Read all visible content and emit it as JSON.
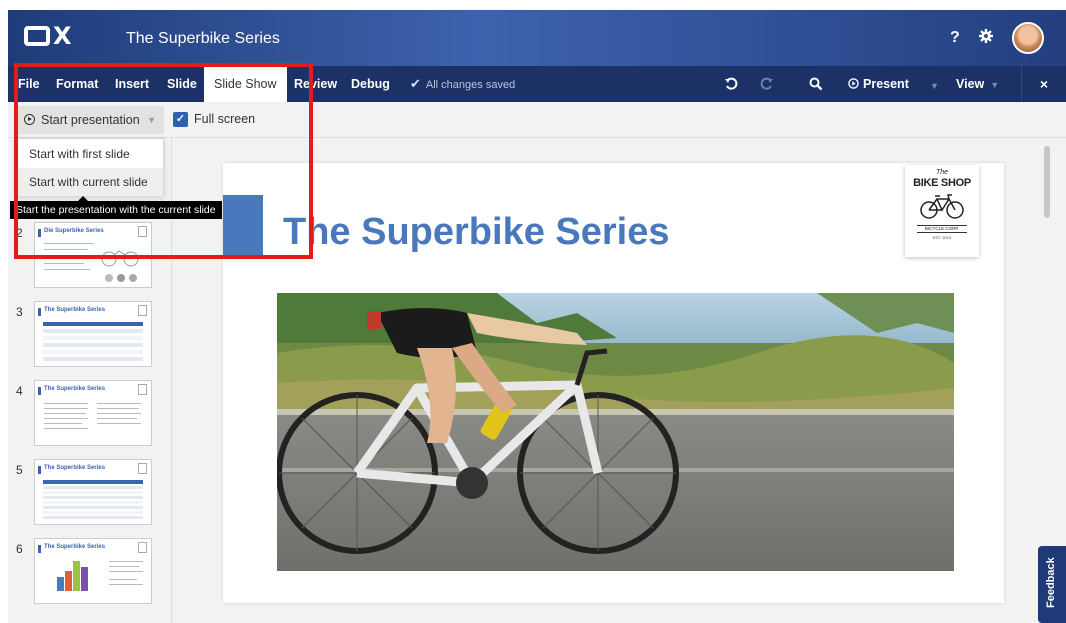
{
  "app": {
    "logo": "OX",
    "document_title": "The Superbike Series",
    "help_icon": "?",
    "settings_icon": "gear-icon",
    "avatar": "user-avatar"
  },
  "ribbon": {
    "tabs": [
      {
        "label": "File"
      },
      {
        "label": "Format"
      },
      {
        "label": "Insert"
      },
      {
        "label": "Slide"
      },
      {
        "label": "Slide Show",
        "active": true
      },
      {
        "label": "Review"
      },
      {
        "label": "Debug"
      }
    ],
    "status": "All changes saved",
    "present_label": "Present",
    "view_label": "View",
    "close_label": "×"
  },
  "toolbar": {
    "start_presentation_label": "Start presentation",
    "full_screen_label": "Full screen",
    "full_screen_checked": true
  },
  "dropdown": {
    "items": [
      {
        "label": "Start with first slide"
      },
      {
        "label": "Start with current slide"
      }
    ],
    "tooltip": "Start the presentation with the current slide"
  },
  "thumbnails": [
    {
      "number": "2",
      "title": "Die Superbike Series"
    },
    {
      "number": "3",
      "title": "The Superbike Series"
    },
    {
      "number": "4",
      "title": "The Superbike Series"
    },
    {
      "number": "5",
      "title": "The Superbike Series"
    },
    {
      "number": "6",
      "title": "The Superbike Series"
    }
  ],
  "slide": {
    "title": "The Superbike Series",
    "logo": {
      "the": "The",
      "name": "BIKE SHOP",
      "corp": "BICYCLE CORP.",
      "est": "EST. 2013"
    },
    "photo": "cyclist-road-bike-photo"
  },
  "feedback_label": "Feedback",
  "colors": {
    "header": "#2b4b93",
    "ribbon": "#1c3266",
    "accent": "#4a78bd",
    "highlight": "#e41b1b"
  }
}
